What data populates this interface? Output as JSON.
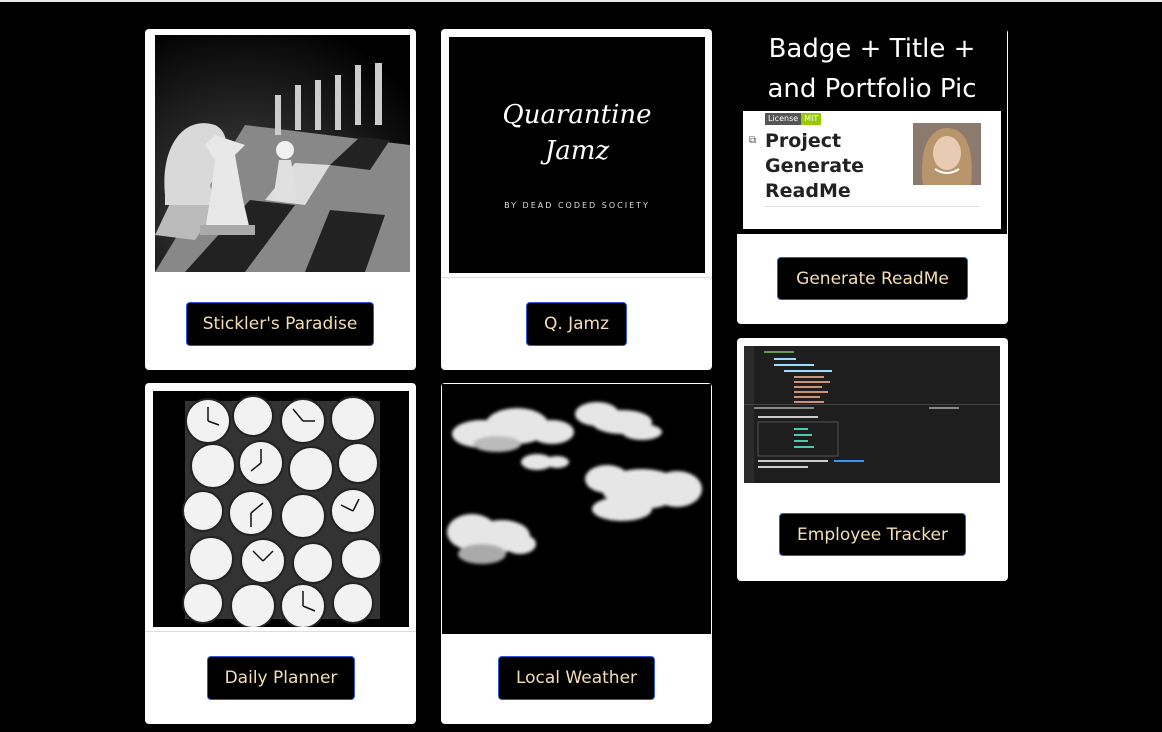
{
  "projects": [
    {
      "button": "Stickler's Paradise",
      "image_icon": "chess-board-icon"
    },
    {
      "button": "Q. Jamz",
      "image_icon": "album-cover-icon",
      "cover_title_1": "Quarantine",
      "cover_title_2": "Jamz",
      "cover_subtitle": "BY DEAD CODED SOCIETY"
    },
    {
      "button": "Generate ReadMe",
      "image_icon": "readme-screenshot-icon",
      "heading_1": "Badge + Title +",
      "heading_2": "and Portfolio Pic",
      "license_label": "License",
      "license_value": "MIT",
      "project_1": "Project",
      "project_2": "Generate",
      "project_3": "ReadMe"
    },
    {
      "button": "Employee Tracker",
      "image_icon": "terminal-screenshot-icon"
    },
    {
      "button": "Daily Planner",
      "image_icon": "clocks-icon"
    },
    {
      "button": "Local Weather",
      "image_icon": "clouds-icon"
    }
  ],
  "colors": {
    "page_bg": "#000000",
    "card_bg": "#ffffff",
    "button_bg": "#000000",
    "button_text": "#f5deb3",
    "button_border": "#2b5bd6"
  }
}
